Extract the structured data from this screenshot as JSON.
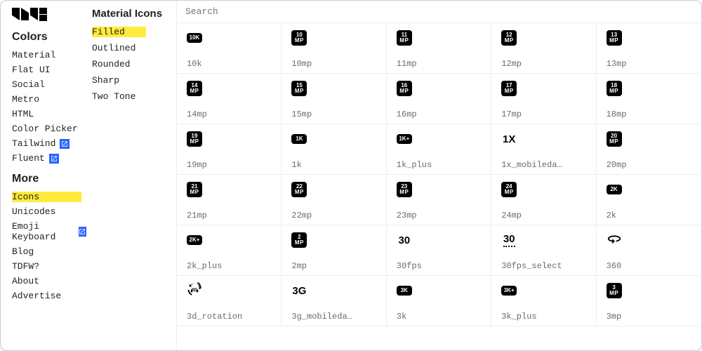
{
  "logo_alt": "MUI",
  "sidebar": {
    "colors_header": "Colors",
    "colors_items": [
      {
        "label": "Material",
        "ext": false
      },
      {
        "label": "Flat UI",
        "ext": false
      },
      {
        "label": "Social",
        "ext": false
      },
      {
        "label": "Metro",
        "ext": false
      },
      {
        "label": "HTML",
        "ext": false
      },
      {
        "label": "Color Picker",
        "ext": false
      },
      {
        "label": "Tailwind",
        "ext": true
      },
      {
        "label": "Fluent",
        "ext": true
      }
    ],
    "more_header": "More",
    "more_items": [
      {
        "label": "Icons",
        "ext": false,
        "active": true
      },
      {
        "label": "Unicodes",
        "ext": false
      },
      {
        "label": "Emoji Keyboard",
        "ext": true
      },
      {
        "label": "Blog",
        "ext": false
      },
      {
        "label": "TDFW?",
        "ext": false
      },
      {
        "label": "About",
        "ext": false
      },
      {
        "label": "Advertise",
        "ext": false
      }
    ]
  },
  "styles": {
    "header": "Material Icons",
    "items": [
      {
        "label": "Filled",
        "active": true
      },
      {
        "label": "Outlined",
        "active": false
      },
      {
        "label": "Rounded",
        "active": false
      },
      {
        "label": "Sharp",
        "active": false
      },
      {
        "label": "Two Tone",
        "active": false
      }
    ]
  },
  "search": {
    "placeholder": "Search"
  },
  "icons": [
    {
      "label": "10k",
      "kind": "badge",
      "t1": "10K"
    },
    {
      "label": "10mp",
      "kind": "badge2",
      "t1": "10",
      "t2": "MP"
    },
    {
      "label": "11mp",
      "kind": "badge2",
      "t1": "11",
      "t2": "MP"
    },
    {
      "label": "12mp",
      "kind": "badge2",
      "t1": "12",
      "t2": "MP"
    },
    {
      "label": "13mp",
      "kind": "badge2",
      "t1": "13",
      "t2": "MP"
    },
    {
      "label": "14mp",
      "kind": "badge2",
      "t1": "14",
      "t2": "MP"
    },
    {
      "label": "15mp",
      "kind": "badge2",
      "t1": "15",
      "t2": "MP"
    },
    {
      "label": "16mp",
      "kind": "badge2",
      "t1": "16",
      "t2": "MP"
    },
    {
      "label": "17mp",
      "kind": "badge2",
      "t1": "17",
      "t2": "MP"
    },
    {
      "label": "18mp",
      "kind": "badge2",
      "t1": "18",
      "t2": "MP"
    },
    {
      "label": "19mp",
      "kind": "badge2",
      "t1": "19",
      "t2": "MP"
    },
    {
      "label": "1k",
      "kind": "badge",
      "t1": "1K"
    },
    {
      "label": "1k_plus",
      "kind": "badge",
      "t1": "1K+"
    },
    {
      "label": "1x_mobileda…",
      "kind": "text",
      "t1": "1X"
    },
    {
      "label": "20mp",
      "kind": "badge2",
      "t1": "20",
      "t2": "MP"
    },
    {
      "label": "21mp",
      "kind": "badge2",
      "t1": "21",
      "t2": "MP"
    },
    {
      "label": "22mp",
      "kind": "badge2",
      "t1": "22",
      "t2": "MP"
    },
    {
      "label": "23mp",
      "kind": "badge2",
      "t1": "23",
      "t2": "MP"
    },
    {
      "label": "24mp",
      "kind": "badge2",
      "t1": "24",
      "t2": "MP"
    },
    {
      "label": "2k",
      "kind": "badge",
      "t1": "2K"
    },
    {
      "label": "2k_plus",
      "kind": "badge",
      "t1": "2K+"
    },
    {
      "label": "2mp",
      "kind": "badge2",
      "t1": "2",
      "t2": "MP"
    },
    {
      "label": "30fps",
      "kind": "text",
      "t1": "30"
    },
    {
      "label": "30fps_select",
      "kind": "text-dotted",
      "t1": "30"
    },
    {
      "label": "360",
      "kind": "svg",
      "svg": "360"
    },
    {
      "label": "3d_rotation",
      "kind": "svg",
      "svg": "3d"
    },
    {
      "label": "3g_mobileda…",
      "kind": "text",
      "t1": "3G"
    },
    {
      "label": "3k",
      "kind": "badge",
      "t1": "3K"
    },
    {
      "label": "3k_plus",
      "kind": "badge",
      "t1": "3K+"
    },
    {
      "label": "3mp",
      "kind": "badge2",
      "t1": "3",
      "t2": "MP"
    }
  ]
}
